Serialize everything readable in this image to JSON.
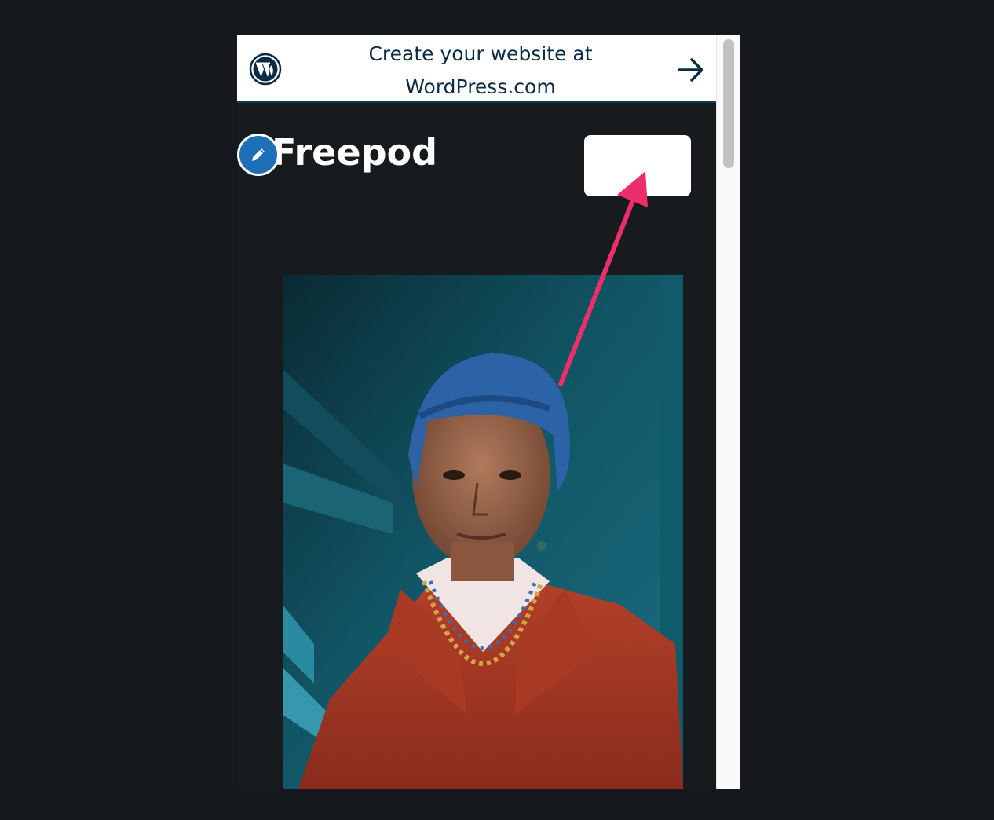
{
  "banner": {
    "line1": "Create your website at",
    "line2": "WordPress.com",
    "logo_icon": "wordpress-logo-icon",
    "arrow_icon": "arrow-right-icon"
  },
  "site": {
    "title": "Freepod",
    "edit_icon": "pencil-icon",
    "menu_button_label": ""
  },
  "hero": {
    "subject": "photo"
  },
  "colors": {
    "page_background": "#15181c",
    "site_background": "#181b1d",
    "banner_text": "#0b2b44",
    "edit_badge": "#1d6fb8",
    "annotation_arrow": "#ee2d6b"
  }
}
